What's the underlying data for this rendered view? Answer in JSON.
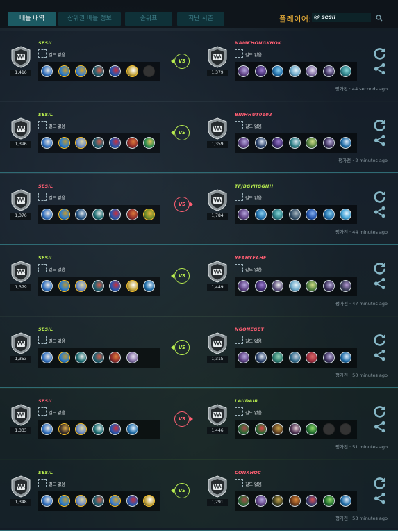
{
  "tabs": [
    {
      "label": "배틀 내역",
      "active": true
    },
    {
      "label": "상위권 배틀 정보",
      "active": false
    },
    {
      "label": "순위표",
      "active": false
    },
    {
      "label": "지난 시즌",
      "active": false
    }
  ],
  "player": {
    "label": "플레이어:",
    "value": "@ sesil",
    "search_icon": "search-icon"
  },
  "colors": {
    "win": "#b8ec4f",
    "lose": "#ff5f73",
    "accent": "#1c5a63",
    "gold": "#ffbe3c"
  },
  "guild_none": "길드 없음",
  "battles": [
    {
      "result": "win",
      "me": {
        "name": "SESIL",
        "rating": "1,416",
        "units": [
          "u1",
          "u2",
          "u3",
          "u4",
          "u5",
          "u6",
          "empty"
        ]
      },
      "opp": {
        "name": "NAMKHONGKHOK",
        "rating": "1,379",
        "units": [
          "u7",
          "u8",
          "u9",
          "u10",
          "u11",
          "u12",
          "u13"
        ]
      },
      "time": "평가전 · 44 seconds ago"
    },
    {
      "result": "win",
      "me": {
        "name": "SESIL",
        "rating": "1,396",
        "units": [
          "u1",
          "u14",
          "u15",
          "u4",
          "u5",
          "u16",
          "u17"
        ]
      },
      "opp": {
        "name": "BINHHUT0103",
        "rating": "1,359",
        "units": [
          "u7",
          "u18",
          "u8",
          "u19",
          "u20",
          "u12",
          "u21"
        ]
      },
      "time": "평가전 · 2 minutes ago"
    },
    {
      "result": "lose",
      "me": {
        "name": "SESIL",
        "rating": "1,376",
        "units": [
          "u1",
          "u2",
          "u22",
          "u23",
          "u5",
          "u16",
          "u24"
        ]
      },
      "opp": {
        "name": "TFJBGYHGGHH",
        "rating": "1,784",
        "units": [
          "u7",
          "u9",
          "u13",
          "u25",
          "u26",
          "u9",
          "u27"
        ]
      },
      "time": "평가전 · 44 minutes ago"
    },
    {
      "result": "win",
      "me": {
        "name": "SESIL",
        "rating": "1,379",
        "units": [
          "u1",
          "u14",
          "u15",
          "u4",
          "u5",
          "u6",
          "u21"
        ]
      },
      "opp": {
        "name": "YEAHYEAHE",
        "rating": "1,449",
        "units": [
          "u7",
          "u8",
          "u28",
          "u10",
          "u20",
          "u12",
          "u29"
        ]
      },
      "time": "평가전 · 47 minutes ago"
    },
    {
      "result": "win",
      "me": {
        "name": "SESIL",
        "rating": "1,353",
        "units": [
          "u1",
          "u14",
          "u23",
          "u4",
          "u16",
          "u11"
        ]
      },
      "opp": {
        "name": "NGONEGET",
        "rating": "1,315",
        "units": [
          "u7",
          "u18",
          "u30",
          "u31",
          "u32",
          "u12",
          "u21"
        ]
      },
      "time": "평가전 · 50 minutes ago"
    },
    {
      "result": "lose",
      "me": {
        "name": "SESIL",
        "rating": "1,333",
        "units": [
          "u1",
          "u33",
          "u15",
          "u23",
          "u5",
          "u21"
        ]
      },
      "opp": {
        "name": "LAUDAIR",
        "rating": "1,446",
        "units": [
          "u34",
          "u35",
          "u36",
          "u37",
          "u38",
          "empty",
          "empty"
        ]
      },
      "time": "평가전 · 51 minutes ago"
    },
    {
      "result": "win",
      "me": {
        "name": "SESIL",
        "rating": "1,348",
        "units": [
          "u1",
          "u14",
          "u15",
          "u4",
          "u3",
          "u5",
          "u6"
        ]
      },
      "opp": {
        "name": "CONKHOC",
        "rating": "1,291",
        "units": [
          "u34",
          "u7",
          "u39",
          "u40",
          "u41",
          "u38",
          "u21"
        ]
      },
      "time": "평가전 · 53 minutes ago"
    }
  ]
}
